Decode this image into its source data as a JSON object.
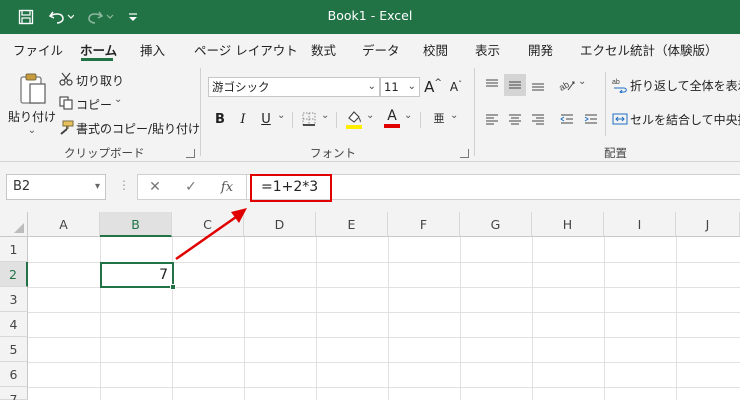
{
  "titlebar": {
    "title": "Book1  -  Excel",
    "save_icon": "save-icon",
    "undo_icon": "undo-icon",
    "redo_icon": "redo-icon",
    "customize_icon": "customize-quick-access-icon"
  },
  "tabs": [
    "ファイル",
    "ホーム",
    "挿入",
    "ページ レイアウト",
    "数式",
    "データ",
    "校閲",
    "表示",
    "開発",
    "エクセル統計（体験版）"
  ],
  "active_tab": "ホーム",
  "ribbon": {
    "clipboard": {
      "paste_label": "貼り付け",
      "cut_label": "切り取り",
      "copy_label": "コピー",
      "format_painter_label": "書式のコピー/貼り付け",
      "group_label": "クリップボード"
    },
    "font": {
      "font_name": "游ゴシック",
      "font_size": "11",
      "grow_label": "A",
      "shrink_label": "A",
      "bold_label": "B",
      "italic_label": "I",
      "underline_label": "U",
      "font_color_label": "A",
      "phonetic_label": "亜",
      "group_label": "フォント",
      "highlight_color": "#ffee00",
      "font_color": "#e00000"
    },
    "alignment": {
      "wrap_text_label": "折り返して全体を表示する",
      "merge_center_label": "セルを結合して中央揃え",
      "group_label": "配置"
    }
  },
  "formula_bar": {
    "name_box": "B2",
    "formula": "=1+2*3",
    "cancel_glyph": "✕",
    "enter_glyph": "✓",
    "fx_glyph": "fx"
  },
  "grid": {
    "columns": [
      "A",
      "B",
      "C",
      "D",
      "E",
      "F",
      "G",
      "H",
      "I",
      "J"
    ],
    "rows": [
      "1",
      "2",
      "3",
      "4",
      "5",
      "6",
      "7"
    ],
    "selected_column": "B",
    "selected_row": "2",
    "active_cell_value": "7"
  },
  "colors": {
    "accent": "#217346",
    "highlight_border": "#e00000",
    "annotation_arrow": "#e00000"
  }
}
